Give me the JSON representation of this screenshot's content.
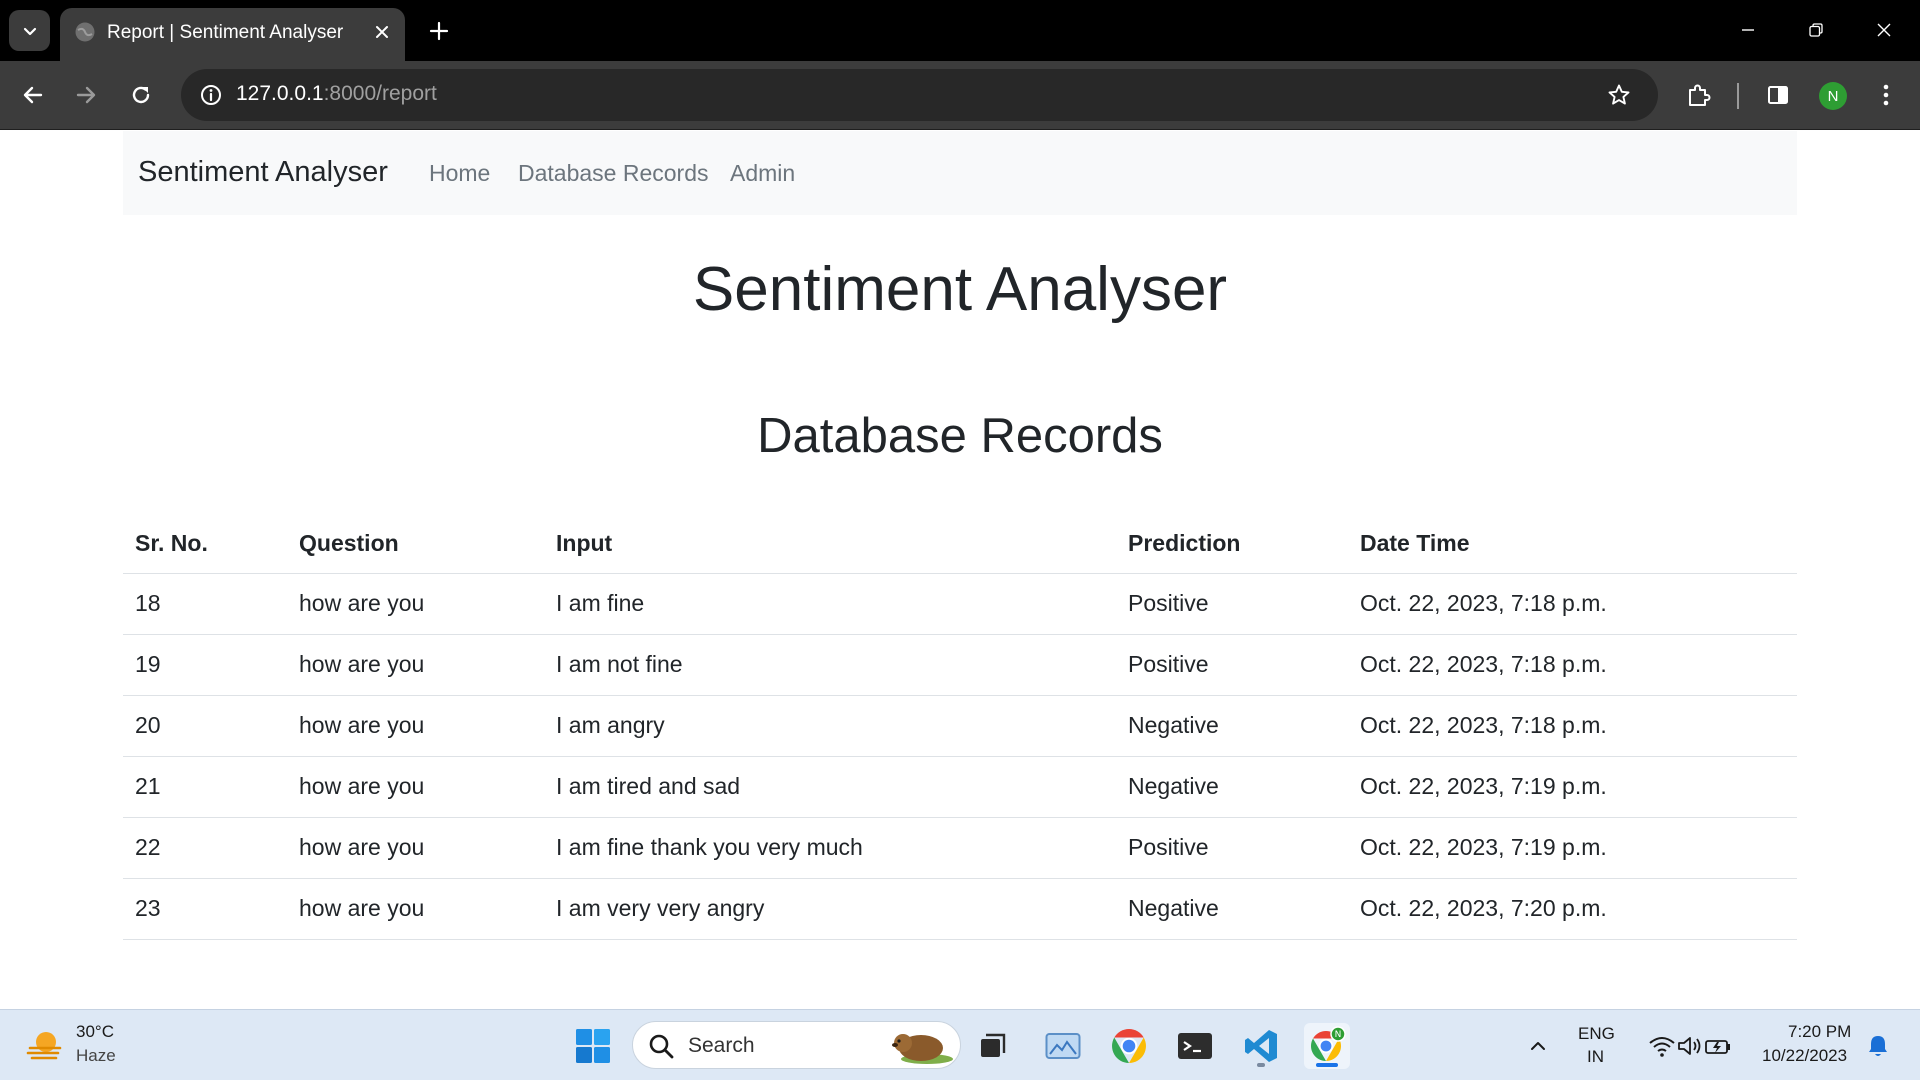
{
  "browser": {
    "tab_title": "Report | Sentiment Analyser",
    "url_host": "127.0.0.1",
    "url_rest": ":8000/report",
    "profile_initial": "N"
  },
  "navbar": {
    "brand": "Sentiment Analyser",
    "links": [
      "Home",
      "Database Records",
      "Admin"
    ]
  },
  "page": {
    "heading": "Sentiment Analyser",
    "subheading": "Database Records"
  },
  "table": {
    "headers": [
      "Sr. No.",
      "Question",
      "Input",
      "Prediction",
      "Date Time"
    ],
    "rows": [
      [
        "18",
        "how are you",
        "I am fine",
        "Positive",
        "Oct. 22, 2023, 7:18 p.m."
      ],
      [
        "19",
        "how are you",
        "I am not fine",
        "Positive",
        "Oct. 22, 2023, 7:18 p.m."
      ],
      [
        "20",
        "how are you",
        "I am angry",
        "Negative",
        "Oct. 22, 2023, 7:18 p.m."
      ],
      [
        "21",
        "how are you",
        "I am tired and sad",
        "Negative",
        "Oct. 22, 2023, 7:19 p.m."
      ],
      [
        "22",
        "how are you",
        "I am fine thank you very much",
        "Positive",
        "Oct. 22, 2023, 7:19 p.m."
      ],
      [
        "23",
        "how are you",
        "I am very very angry",
        "Negative",
        "Oct. 22, 2023, 7:20 p.m."
      ]
    ]
  },
  "taskbar": {
    "weather_temp": "30°C",
    "weather_desc": "Haze",
    "search_label": "Search",
    "lang_line1": "ENG",
    "lang_line2": "IN",
    "time": "7:20 PM",
    "date": "10/22/2023"
  }
}
